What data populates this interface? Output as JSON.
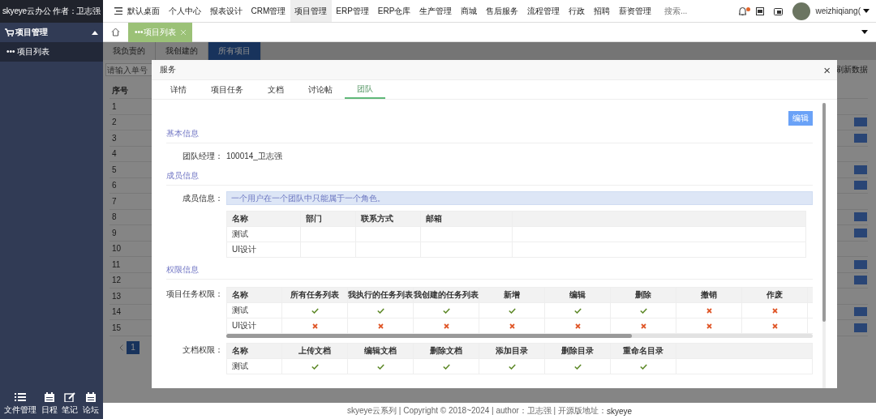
{
  "sidebar": {
    "brand": "skyeye云办公 作者：卫志强",
    "menu": [
      {
        "label": "项目管理",
        "expanded": true,
        "children": [
          {
            "label": "••• 项目列表",
            "selected": true
          }
        ]
      }
    ],
    "bottom_items": [
      {
        "label": "文件管理"
      },
      {
        "label": "日程"
      },
      {
        "label": "笔记"
      },
      {
        "label": "论坛"
      }
    ]
  },
  "top_nav": {
    "items": [
      {
        "label": "默认桌面",
        "selected": false
      },
      {
        "label": "个人中心",
        "selected": false
      },
      {
        "label": "报表设计",
        "selected": false
      },
      {
        "label": "CRM管理",
        "selected": false
      },
      {
        "label": "项目管理",
        "selected": true
      },
      {
        "label": "ERP管理",
        "selected": false
      },
      {
        "label": "ERP仓库",
        "selected": false
      },
      {
        "label": "生产管理",
        "selected": false
      },
      {
        "label": "商城",
        "selected": false
      },
      {
        "label": "售后服务",
        "selected": false
      },
      {
        "label": "流程管理",
        "selected": false
      },
      {
        "label": "行政",
        "selected": false
      },
      {
        "label": "招聘",
        "selected": false
      },
      {
        "label": "薪资管理",
        "selected": false
      }
    ],
    "search": {
      "placeholder": "搜索..."
    },
    "unread": true,
    "user": {
      "name": "weizhiqiang("
    }
  },
  "tab_bar": {
    "tabs": [
      {
        "label": "•••项目列表",
        "selected": true
      }
    ]
  },
  "page": {
    "subtabs": [
      {
        "label": "我负责的",
        "selected": false
      },
      {
        "label": "我创建的",
        "selected": false
      },
      {
        "label": "所有项目",
        "selected": true
      }
    ],
    "search": {
      "placeholder": "请输入单号"
    },
    "refresh": "刷新数据",
    "table": {
      "columns": [
        "序号"
      ],
      "rows": [
        "1",
        "2",
        "3",
        "4",
        "5",
        "6",
        "7",
        "8",
        "9",
        "10",
        "11",
        "12",
        "13",
        "14",
        "15"
      ]
    },
    "pagination": [
      {
        "label": "1",
        "selected": true
      }
    ]
  },
  "modal": {
    "title": "服务",
    "close": "×",
    "tabs": [
      {
        "label": "详情",
        "selected": false
      },
      {
        "label": "项目任务",
        "selected": false
      },
      {
        "label": "文档",
        "selected": false
      },
      {
        "label": "讨论帖",
        "selected": false
      },
      {
        "label": "团队",
        "selected": true
      }
    ],
    "edit_button": "编辑",
    "basic": {
      "heading": "基本信息",
      "fields": [
        {
          "label": "团队经理：",
          "value": "100014_卫志强"
        }
      ]
    },
    "members": {
      "heading": "成员信息",
      "label": "成员信息：",
      "notice": "一个用户在一个团队中只能属于一个角色。",
      "columns": [
        "名称",
        "部门",
        "联系方式",
        "邮箱"
      ],
      "rows": [
        {
          "name": "测试"
        },
        {
          "name": "UI设计"
        }
      ]
    },
    "permissions": {
      "heading": "权限信息",
      "tables": [
        {
          "label": "项目任务权限：",
          "columns": [
            "名称",
            "所有任务列表",
            "我执行的任务列表",
            "我创建的任务列表",
            "新增",
            "编辑",
            "删除",
            "撤销",
            "作废"
          ],
          "rows": [
            {
              "name": "测试",
              "values": [
                true,
                true,
                true,
                true,
                true,
                true,
                false,
                false
              ]
            },
            {
              "name": "UI设计",
              "values": [
                false,
                false,
                false,
                false,
                false,
                false,
                false,
                false
              ]
            }
          ]
        },
        {
          "label": "文档权限：",
          "columns": [
            "名称",
            "上传文档",
            "编辑文档",
            "删除文档",
            "添加目录",
            "删除目录",
            "重命名目录"
          ],
          "rows": [
            {
              "name": "测试",
              "values": [
                true,
                true,
                true,
                true,
                true,
                true
              ]
            }
          ]
        }
      ]
    }
  },
  "footer": {
    "text": "skyeye云系列 | Copyright © 2018~2024 | author：卫志强 | 开源版地址：",
    "link": "skyeye"
  }
}
